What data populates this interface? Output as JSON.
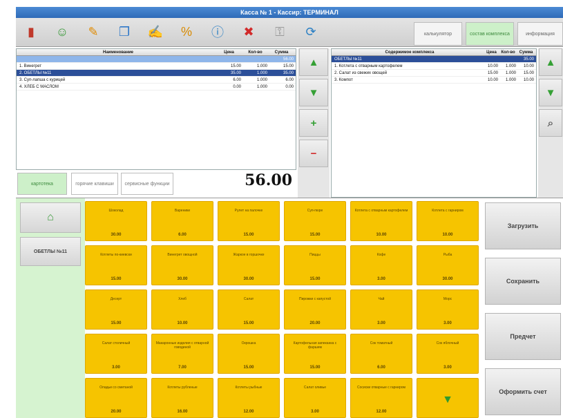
{
  "window": {
    "title": "Касса № 1 - Кассир: ТЕРМИНАЛ"
  },
  "toolbar": {
    "icons": [
      "exit-icon",
      "user-icon",
      "tools-icon",
      "copy-icon",
      "edit-icon",
      "discount-icon",
      "info-icon",
      "delete-icon",
      "key-icon",
      "refresh-icon"
    ],
    "tabs": [
      {
        "label": "калькулятор"
      },
      {
        "label": "состав комплекса"
      },
      {
        "label": "информация"
      }
    ]
  },
  "order": {
    "columns": {
      "name": "Наименование",
      "price": "Цена",
      "qty": "Кол-во",
      "sum": "Сумма"
    },
    "header_row": {
      "name": "",
      "price": "",
      "qty": "",
      "sum": "56.00"
    },
    "rows": [
      {
        "name": "1. Винегрет",
        "price": "15.00",
        "qty": "1.000",
        "sum": "15.00",
        "selected": false
      },
      {
        "name": "2. ОБЕТЛЫ №11",
        "price": "35.00",
        "qty": "1.000",
        "sum": "35.00",
        "selected": true
      },
      {
        "name": "3. Суп-лапша с курицей",
        "price": "6.00",
        "qty": "1.000",
        "sum": "6.00",
        "selected": false
      },
      {
        "name": "4. ХЛЕБ С МАСЛОМ",
        "price": "0.00",
        "qty": "1.000",
        "sum": "0.00",
        "selected": false
      }
    ],
    "total": "56.00"
  },
  "complex": {
    "columns": {
      "name": "Содержимое комплекса",
      "price": "Цена",
      "qty": "Кол-во",
      "sum": "Сумма"
    },
    "rows": [
      {
        "name": "ОБЕТЛЫ №11",
        "price": "",
        "qty": "",
        "sum": "35.00",
        "selected": true
      },
      {
        "name": "1. Котлета с отварным картофелем",
        "price": "10.00",
        "qty": "1.000",
        "sum": "10.00",
        "selected": false
      },
      {
        "name": "2. Салат из свежих овощей",
        "price": "15.00",
        "qty": "1.000",
        "sum": "15.00",
        "selected": false
      },
      {
        "name": "3. Компот",
        "price": "10.00",
        "qty": "1.000",
        "sum": "10.00",
        "selected": false
      }
    ]
  },
  "bottom_tabs": [
    {
      "label": "картотека"
    },
    {
      "label": "горячие клавиши"
    },
    {
      "label": "сервисные функции"
    }
  ],
  "categories": [
    {
      "label": ""
    },
    {
      "label": "ОБЕТЛЫ №11"
    }
  ],
  "tiles": [
    {
      "name": "Шоколад",
      "price": "30.00"
    },
    {
      "name": "Вареники",
      "price": "6.00"
    },
    {
      "name": "Рулет на палочке",
      "price": "15.00"
    },
    {
      "name": "Суп-пюре",
      "price": "15.00"
    },
    {
      "name": "Котлета с отварным картофелем",
      "price": "10.00"
    },
    {
      "name": "Котлета с гарниром",
      "price": "10.00"
    },
    {
      "name": "Котлеты по-киевски",
      "price": "15.00"
    },
    {
      "name": "Винегрет овощной",
      "price": "30.00"
    },
    {
      "name": "Жаркое в горшочке",
      "price": "30.00"
    },
    {
      "name": "Пиццы",
      "price": "15.00"
    },
    {
      "name": "Кофе",
      "price": "3.00"
    },
    {
      "name": "Рыба",
      "price": "30.00"
    },
    {
      "name": "Десерт",
      "price": "15.00"
    },
    {
      "name": "Хлеб",
      "price": "10.00"
    },
    {
      "name": "Салат",
      "price": "15.00"
    },
    {
      "name": "Пирожки с капустой",
      "price": "20.00"
    },
    {
      "name": "Чай",
      "price": "3.00"
    },
    {
      "name": "Морс",
      "price": "3.00"
    },
    {
      "name": "Салат столичный",
      "price": "3.00"
    },
    {
      "name": "Макаронные изделия с отварной говядиной",
      "price": "7.00"
    },
    {
      "name": "Окрошка",
      "price": "15.00"
    },
    {
      "name": "Картофельная запеканка с фаршем",
      "price": "15.00"
    },
    {
      "name": "Сок томатный",
      "price": "6.00"
    },
    {
      "name": "Сок яблочный",
      "price": "3.00"
    },
    {
      "name": "Оладьи со сметаной",
      "price": "20.00"
    },
    {
      "name": "Котлеты рубленые",
      "price": "16.00"
    },
    {
      "name": "Котлеты рыбные",
      "price": "12.00"
    },
    {
      "name": "Салат оливье",
      "price": "3.00"
    },
    {
      "name": "Сосиски отварные с гарниром",
      "price": "12.00"
    },
    {
      "name": "",
      "price": ""
    }
  ],
  "actions": [
    {
      "label": "Загрузить"
    },
    {
      "label": "Сохранить"
    },
    {
      "label": "Предчет"
    },
    {
      "label": "Оформить счет"
    }
  ]
}
